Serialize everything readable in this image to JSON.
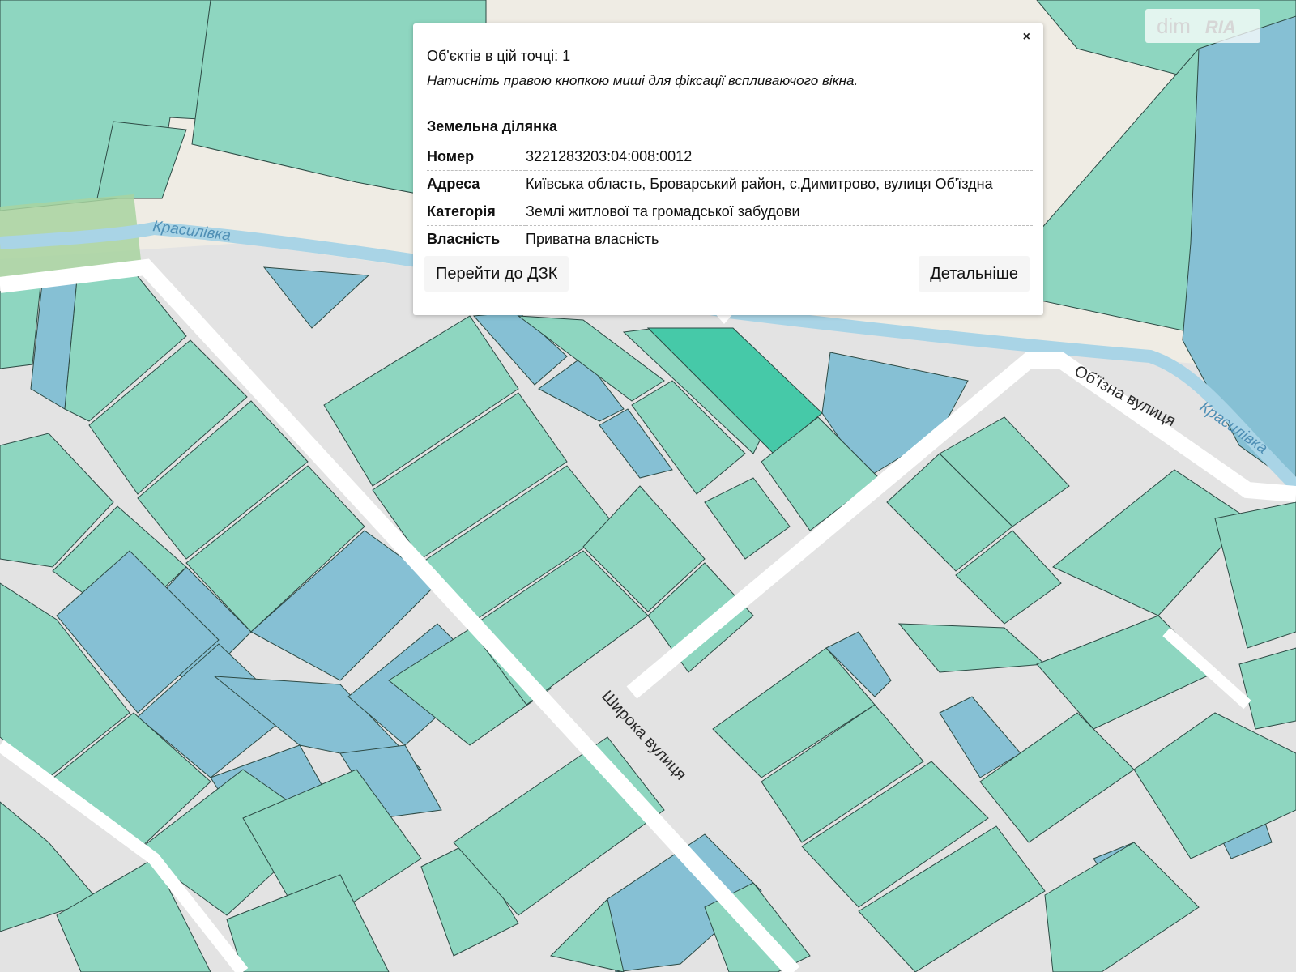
{
  "map": {
    "streets": [
      {
        "id": "krasylivka-west",
        "label": "Красилівка",
        "kind": "river"
      },
      {
        "id": "krasylivka-east",
        "label": "Красилівка",
        "kind": "river"
      },
      {
        "id": "obizna",
        "label": "Об'їзна вулиця",
        "kind": "street"
      },
      {
        "id": "shyroka",
        "label": "Широка вулиця",
        "kind": "street"
      }
    ],
    "colors": {
      "residential": "#8ed6c0",
      "other": "#86c0d4",
      "selected": "#46c9a8",
      "road": "#ffffff",
      "background": "#e3e3e3"
    }
  },
  "popup": {
    "count_text": "Об'єктів в цій точці: 1",
    "hint": "Натисніть правою кнопкою миші для фіксації вспливаючого вікна.",
    "section_title": "Земельна ділянка",
    "rows": [
      {
        "key": "Номер",
        "value": "3221283203:04:008:0012"
      },
      {
        "key": "Адреса",
        "value": "Київська область, Броварський район, с.Димитрово, вулиця Об'їздна"
      },
      {
        "key": "Категорія",
        "value": "Землі житлової та громадської забудови"
      },
      {
        "key": "Власність",
        "value": "Приватна власність"
      }
    ],
    "buttons": {
      "dzk": "Перейти до ДЗК",
      "more": "Детальніше"
    },
    "close_label": "×"
  },
  "watermark": {
    "brand": "dim",
    "suffix": "RIA"
  }
}
